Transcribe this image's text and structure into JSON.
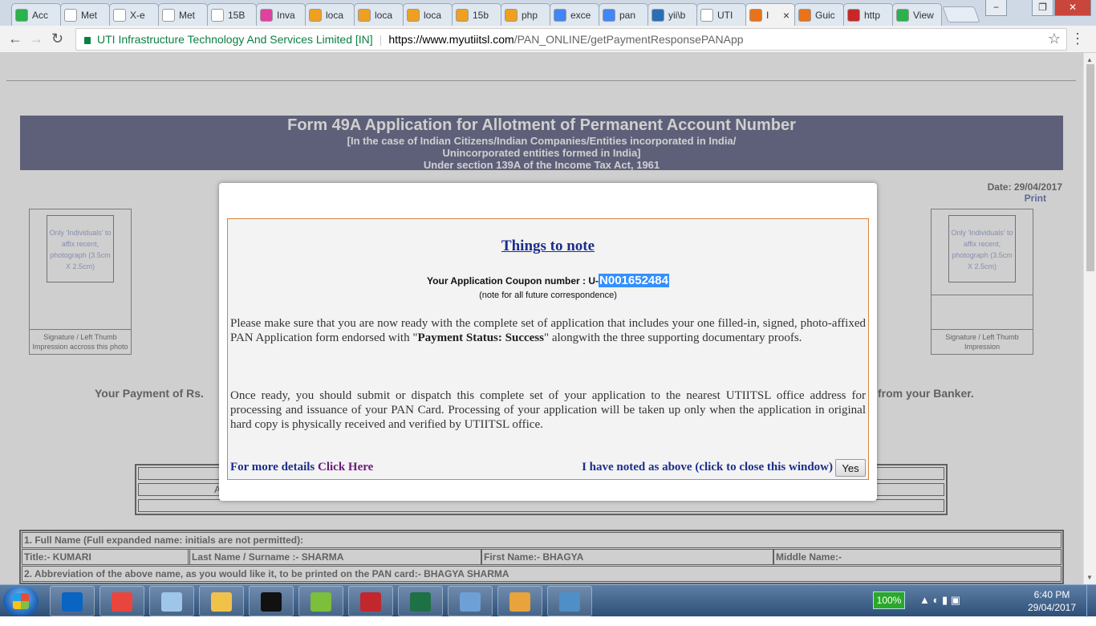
{
  "browser": {
    "tabs": [
      {
        "label": "Acc",
        "fav_color": "#2bb24c"
      },
      {
        "label": "Met",
        "fav_color": "#ffffff"
      },
      {
        "label": "X-e",
        "fav_color": "#ffffff"
      },
      {
        "label": "Met",
        "fav_color": "#ffffff"
      },
      {
        "label": "15B",
        "fav_color": "#ffffff"
      },
      {
        "label": "Inva",
        "fav_color": "#e040a0"
      },
      {
        "label": "loca",
        "fav_color": "#f0a020"
      },
      {
        "label": "loca",
        "fav_color": "#f0a020"
      },
      {
        "label": "loca",
        "fav_color": "#f0a020"
      },
      {
        "label": "15b",
        "fav_color": "#f0a020"
      },
      {
        "label": "php",
        "fav_color": "#f0a020"
      },
      {
        "label": "exce",
        "fav_color": "#4285f4"
      },
      {
        "label": "pan",
        "fav_color": "#4285f4"
      },
      {
        "label": "yii\\b",
        "fav_color": "#2a6fb6"
      },
      {
        "label": "UTI",
        "fav_color": "#ffffff"
      },
      {
        "label": "I",
        "fav_color": "#e8731a",
        "active": true
      },
      {
        "label": "Guic",
        "fav_color": "#e8731a"
      },
      {
        "label": "http",
        "fav_color": "#c62828"
      },
      {
        "label": "View",
        "fav_color": "#2bb24c"
      }
    ],
    "active_tab_close": "×",
    "window_controls": [
      "−",
      "❐",
      "✕"
    ],
    "back_icon": "←",
    "forward_icon": "→",
    "reload_icon": "↻",
    "secure_label": "UTI Infrastructure Technology And Services Limited [IN]",
    "url_host": "https://www.myutiitsl.com",
    "url_path": "/PAN_ONLINE/getPaymentResponsePANApp",
    "star_icon": "☆",
    "menu_icon": "⋮"
  },
  "page": {
    "banner": {
      "title": "Form 49A Application for Allotment of Permanent Account Number",
      "sub1": "[In the case of Indian Citizens/Indian Companies/Entities incorporated in India/",
      "sub2": "Unincorporated entities formed in India]",
      "sub3": "Under section 139A of the Income Tax Act, 1961"
    },
    "date": "Date: 29/04/2017",
    "print": "Print",
    "photo_left": {
      "text": "Only 'Individuals' to affix recent, photograph (3.5cm X 2.5cm)",
      "sig": "Signature / Left Thumb Impression accross this photo"
    },
    "photo_right": {
      "text": "Only 'Individuals' to affix recent, photograph (3.5cm X 2.5cm)",
      "sig": "Signature / Left Thumb Impression"
    },
    "pay_left": "Your Payment of Rs.",
    "pay_right": "from your Banker.",
    "midtable_letter": "A",
    "form": {
      "row1": "1. Full Name (Full expanded name: initials are not permitted):",
      "title": "Title:-  KUMARI",
      "last": "Last Name / Surname :-   SHARMA",
      "first": "First Name:-  BHAGYA",
      "middle": "Middle Name:-",
      "row3": "2. Abbreviation of the above name, as you would like it, to be printed on the PAN card:-  BHAGYA SHARMA"
    }
  },
  "modal": {
    "title": "Things to note",
    "coupon_label": "Your Application Coupon number : U-",
    "coupon_number": "N001652484",
    "coupon_note": "(note for all future correspondence)",
    "para1_a": "Please make sure that you are now ready with the complete set of application that includes your one filled-in, signed, photo-affixed PAN Application form endorsed with \"",
    "para1_b": "Payment Status: Success",
    "para1_c": "\" alongwith the three supporting documentary proofs.",
    "para2": "Once ready, you should submit or dispatch this complete set of your application to the nearest UTIITSL office address for processing and issuance of your PAN Card. Processing of your application will be taken up only when the application in original hard copy is physically received and verified by UTIITSL office.",
    "more_prefix": "For more details",
    "more_link": "Click Here",
    "noted": "I have noted as above (click to close this window)",
    "yes": "Yes"
  },
  "taskbar": {
    "apps": [
      {
        "name": "outlook",
        "color": "#0a64c2"
      },
      {
        "name": "chrome",
        "color": "#e8453c"
      },
      {
        "name": "notepad",
        "color": "#9ec6e8"
      },
      {
        "name": "explorer",
        "color": "#f1c24a"
      },
      {
        "name": "cmd",
        "color": "#111111"
      },
      {
        "name": "notepad-plus",
        "color": "#7bbf3a"
      },
      {
        "name": "filezilla",
        "color": "#c1272d"
      },
      {
        "name": "excel",
        "color": "#1e7145"
      },
      {
        "name": "virtualbox",
        "color": "#6da0d6"
      },
      {
        "name": "paint",
        "color": "#e8a33c"
      },
      {
        "name": "photo-viewer",
        "color": "#4e8fc7"
      }
    ],
    "battery": "100%",
    "time": "6:40 PM",
    "date": "29/04/2017"
  }
}
